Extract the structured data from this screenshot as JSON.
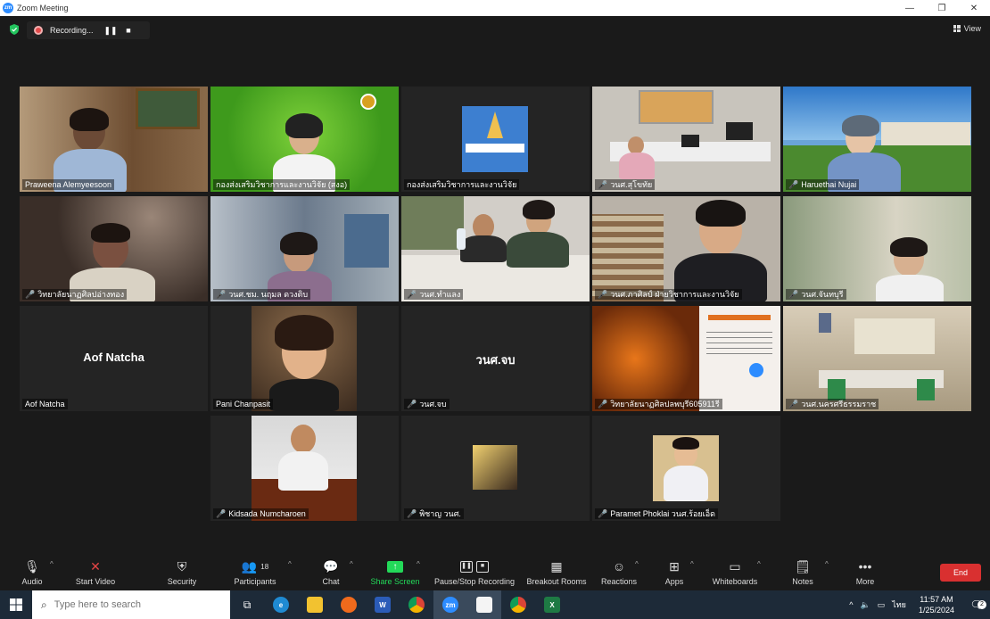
{
  "window": {
    "title": "Zoom Meeting",
    "app_logo": "zm"
  },
  "recording": {
    "label": "Recording...",
    "pause": "❚❚",
    "stop": "■"
  },
  "view": {
    "label": "View"
  },
  "participants": [
    {
      "name": "Praweena Alemyeesoon",
      "muted": false
    },
    {
      "name": "กองส่งเสริมวิชาการและงานวิจัย (สงอ)",
      "muted": false
    },
    {
      "name": "กองส่งเสริมวิชาการและงานวิจัย",
      "muted": false
    },
    {
      "name": "วนศ.สุโขทัย",
      "muted": true
    },
    {
      "name": "Haruethai Nujai",
      "muted": true
    },
    {
      "name": "วิทยาลัยนาฏศิลปอ่างทอง",
      "muted": true
    },
    {
      "name": "วนศ.ชม. นฤมล  ดวงติบ",
      "muted": true
    },
    {
      "name": "วนศ.ทำแลง",
      "muted": true
    },
    {
      "name": "วนศ.ภาศิลป์ ฝ่ายวิชาการและงานวิจัย",
      "muted": true
    },
    {
      "name": "วนศ.จันทบุรี",
      "muted": true
    },
    {
      "name": "Aof Natcha",
      "muted": false,
      "display": "Aof Natcha"
    },
    {
      "name": "Pani Chanpasit",
      "muted": false
    },
    {
      "name": "วนศ.จบ",
      "muted": true,
      "display": "วนศ.จบ"
    },
    {
      "name": "วิทยาลัยนาฏศิลปลพบุรี605911รี",
      "muted": true
    },
    {
      "name": "วนศ.นครศรีธรรมราช",
      "muted": true
    },
    {
      "name": "Kidsada Numcharoen",
      "muted": true
    },
    {
      "name": "พิชาญ วนศ.",
      "muted": true
    },
    {
      "name": "Paramet Phoklai วนศ.ร้อยเอ็ด",
      "muted": true
    }
  ],
  "toolbar": {
    "audio": "Audio",
    "video": "Start Video",
    "security": "Security",
    "participants": "Participants",
    "participants_count": "18",
    "chat": "Chat",
    "share": "Share Screen",
    "recording": "Pause/Stop Recording",
    "breakout": "Breakout Rooms",
    "reactions": "Reactions",
    "apps": "Apps",
    "whiteboards": "Whiteboards",
    "notes": "Notes",
    "more": "More",
    "end": "End",
    "share_color": "#23d959",
    "end_color": "#d93030"
  },
  "taskbar": {
    "search_placeholder": "Type here to search",
    "time": "11:57 AM",
    "date": "1/25/2024",
    "lang": "ไทย",
    "notifications": "2"
  }
}
